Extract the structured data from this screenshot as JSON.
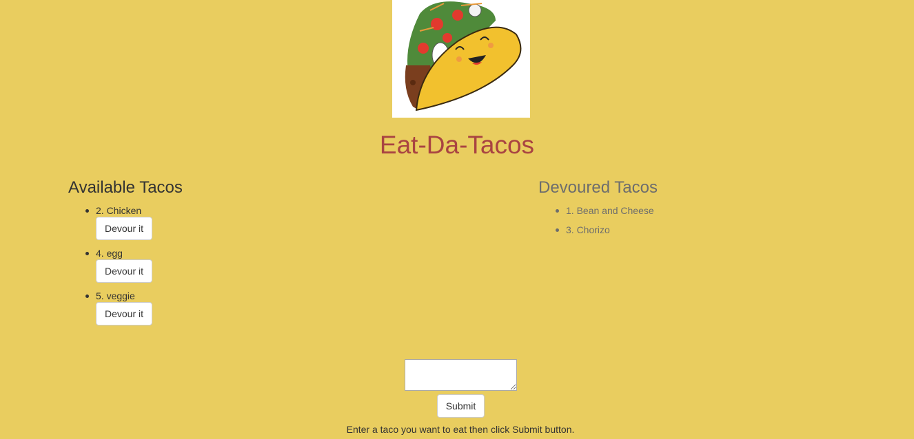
{
  "header": {
    "logo_alt": "Smiling taco logo",
    "title": "Eat-Da-Tacos"
  },
  "available": {
    "heading": "Available Tacos",
    "items": [
      {
        "label": "2. Chicken",
        "button": "Devour it"
      },
      {
        "label": "4. egg",
        "button": "Devour it"
      },
      {
        "label": "5. veggie",
        "button": "Devour it"
      }
    ]
  },
  "devoured": {
    "heading": "Devoured Tacos",
    "items": [
      {
        "label": "1. Bean and Cheese"
      },
      {
        "label": "3. Chorizo"
      }
    ]
  },
  "form": {
    "input_value": "",
    "submit_label": "Submit",
    "instructions": "Enter a taco you want to eat then click Submit button."
  },
  "colors": {
    "background": "#e9cd5f",
    "title": "#a94442",
    "devoured_text": "#6d6d6d"
  }
}
